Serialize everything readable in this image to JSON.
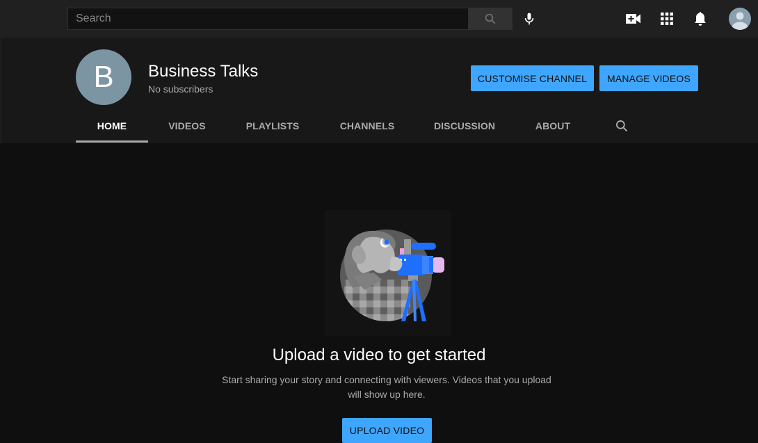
{
  "topbar": {
    "search": {
      "placeholder": "Search",
      "value": ""
    },
    "icons": [
      "search-icon",
      "mic-icon",
      "create-video-icon",
      "apps-grid-icon",
      "notifications-bell-icon",
      "account-avatar-icon"
    ]
  },
  "channel": {
    "avatar_letter": "B",
    "name": "Business Talks",
    "subscribers": "No subscribers",
    "buttons": {
      "customise": "CUSTOMISE CHANNEL",
      "manage": "MANAGE VIDEOS"
    },
    "tabs": [
      {
        "label": "HOME",
        "active": true
      },
      {
        "label": "VIDEOS",
        "active": false
      },
      {
        "label": "PLAYLISTS",
        "active": false
      },
      {
        "label": "CHANNELS",
        "active": false
      },
      {
        "label": "DISCUSSION",
        "active": false
      },
      {
        "label": "ABOUT",
        "active": false
      }
    ]
  },
  "empty_state": {
    "title": "Upload a video to get started",
    "description": "Start sharing your story and connecting with viewers. Videos that you upload will show up here.",
    "button": "UPLOAD VIDEO",
    "illustration": "videographer-with-camera"
  },
  "colors": {
    "accent": "#3ea6ff",
    "topbar_bg": "#202020",
    "header_bg": "#181818",
    "page_bg": "#0f0f0f",
    "avatar_bg": "#7c95a3"
  }
}
